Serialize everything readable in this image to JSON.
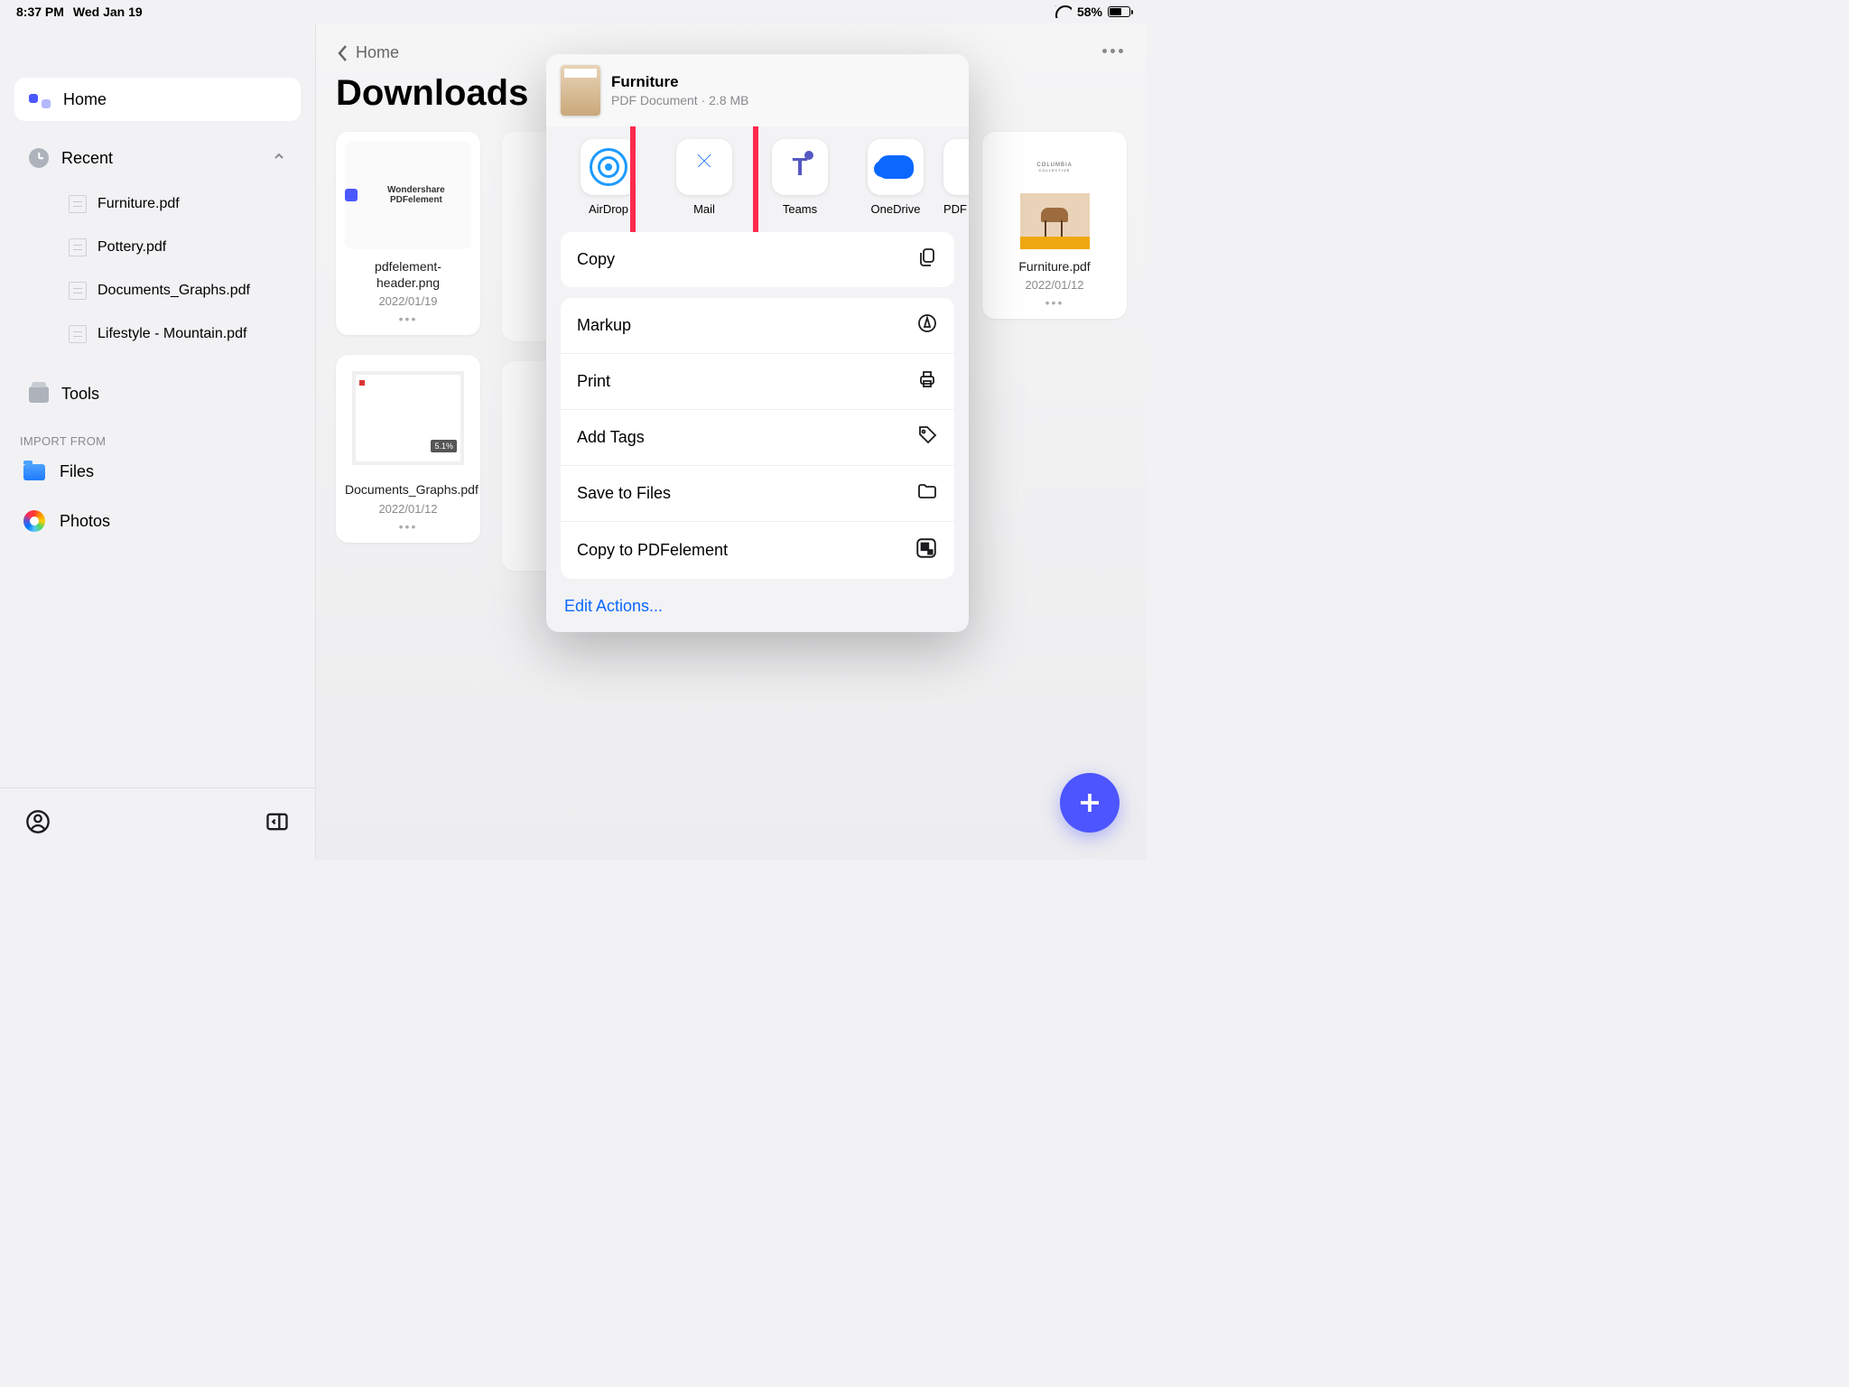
{
  "statusbar": {
    "time": "8:37 PM",
    "date": "Wed Jan 19",
    "battery": "58%"
  },
  "sidebar": {
    "home": "Home",
    "recent": "Recent",
    "recent_files": [
      {
        "name": "Furniture.pdf"
      },
      {
        "name": "Pottery.pdf"
      },
      {
        "name": "Documents_Graphs.pdf"
      },
      {
        "name": "Lifestyle - Mountain.pdf"
      }
    ],
    "tools": "Tools",
    "import_label": "IMPORT FROM",
    "import_files": "Files",
    "import_photos": "Photos"
  },
  "content": {
    "back": "Home",
    "title": "Downloads",
    "cards": [
      {
        "name": "pdfelement-header.png",
        "date": "2022/01/19",
        "thumb_label": "Wondershare PDFelement"
      },
      {
        "name": "Documents_Graphs.pdf",
        "date": "2022/01/12"
      },
      {
        "name": "Furniture.pdf",
        "date": "2022/01/12",
        "thumb_brand": "COLUMBIA",
        "thumb_sub": "COLLECTIVE"
      }
    ]
  },
  "share": {
    "file": "Furniture",
    "subtitle": "PDF Document · 2.8 MB",
    "apps": [
      {
        "label": "AirDrop"
      },
      {
        "label": "Mail"
      },
      {
        "label": "Teams"
      },
      {
        "label": "OneDrive"
      },
      {
        "label": "PDF"
      }
    ],
    "actions": [
      {
        "label": "Copy",
        "icon": "copy"
      },
      {
        "label": "Markup",
        "icon": "markup"
      },
      {
        "label": "Print",
        "icon": "print"
      },
      {
        "label": "Add Tags",
        "icon": "tag"
      },
      {
        "label": "Save to Files",
        "icon": "folder"
      },
      {
        "label": "Copy to PDFelement",
        "icon": "pdfelement"
      }
    ],
    "edit": "Edit Actions..."
  }
}
